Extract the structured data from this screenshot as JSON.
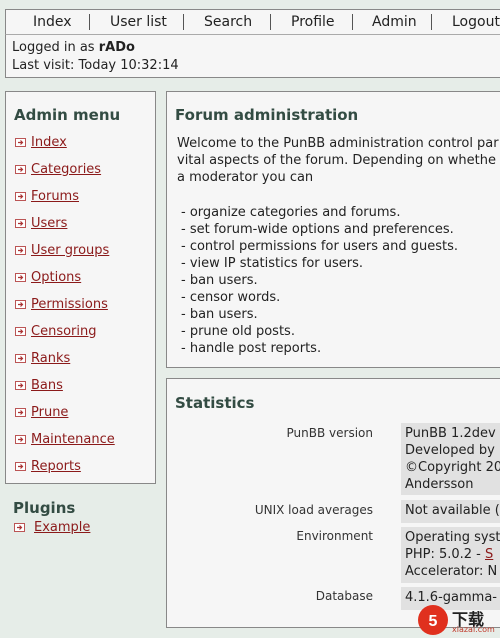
{
  "nav": {
    "items": [
      "Index",
      "User list",
      "Search",
      "Profile",
      "Admin",
      "Logout"
    ]
  },
  "user": {
    "logged_in_prefix": "Logged in as",
    "username": "rADo",
    "last_visit": "Last visit: Today 10:32:14"
  },
  "admin_menu": {
    "title": "Admin menu",
    "items": [
      "Index",
      "Categories",
      "Forums",
      "Users",
      "User groups",
      "Options",
      "Permissions",
      "Censoring",
      "Ranks",
      "Bans",
      "Prune",
      "Maintenance",
      "Reports"
    ]
  },
  "plugins": {
    "title": "Plugins",
    "items": [
      "Example"
    ]
  },
  "forum_admin": {
    "title": "Forum administration",
    "intro": [
      "Welcome to the PunBB administration control par",
      "vital aspects of the forum. Depending on whethe",
      "a moderator you can"
    ],
    "list": [
      "- organize categories and forums.",
      "- set forum-wide options and preferences.",
      "- control permissions for users and guests.",
      "- view IP statistics for users.",
      "- ban users.",
      "- censor words.",
      "- ban users.",
      "- prune old posts.",
      "- handle post reports."
    ]
  },
  "statistics": {
    "title": "Statistics",
    "rows": [
      {
        "label": "PunBB version",
        "lines": [
          "PunBB 1.2dev",
          "Developed by",
          "©Copyright 20",
          "Andersson"
        ]
      },
      {
        "label": "UNIX load averages",
        "lines": [
          "Not available ("
        ]
      },
      {
        "label": "Environment",
        "lines": [
          "Operating syst",
          "PHP: 5.0.2 - ",
          "Accelerator: N"
        ],
        "link": "S"
      },
      {
        "label": "Database",
        "lines": [
          "4.1.6-gamma-"
        ]
      }
    ]
  },
  "watermark": {
    "text": "下载",
    "url": "xiazai.com"
  }
}
